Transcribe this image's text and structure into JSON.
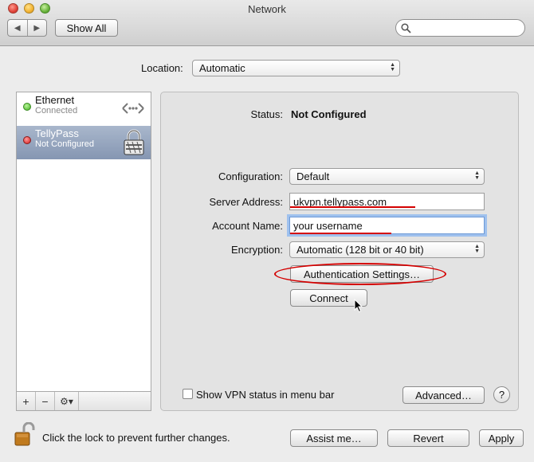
{
  "window": {
    "title": "Network"
  },
  "toolbar": {
    "back": "◀",
    "forward": "▶",
    "show_all": "Show All",
    "search_placeholder": ""
  },
  "location": {
    "label": "Location:",
    "value": "Automatic"
  },
  "sidebar": {
    "services": [
      {
        "name": "Ethernet",
        "status": "Connected",
        "status_color": "#3fae1e",
        "icon": "ethernet-icon"
      },
      {
        "name": "TellyPass",
        "status": "Not Configured",
        "status_color": "#d21c1c",
        "icon": "vpn-lock-icon"
      }
    ],
    "add": "+",
    "remove": "−",
    "gear": "⚙▾"
  },
  "panel": {
    "status_label": "Status:",
    "status_value": "Not Configured",
    "configuration_label": "Configuration:",
    "configuration_value": "Default",
    "server_label": "Server Address:",
    "server_value": "ukvpn.tellypass.com",
    "account_label": "Account Name:",
    "account_value": "your username",
    "encryption_label": "Encryption:",
    "encryption_value": "Automatic (128 bit or 40 bit)",
    "auth_button": "Authentication Settings…",
    "connect_button": "Connect",
    "show_vpn_label": "Show VPN status in menu bar",
    "advanced_button": "Advanced…",
    "help": "?"
  },
  "footer": {
    "lock_text": "Click the lock to prevent further changes.",
    "assist_button": "Assist me…",
    "revert_button": "Revert",
    "apply_button": "Apply"
  },
  "colors": {
    "annotation_red": "#d40000",
    "selection": "#8596b2"
  }
}
